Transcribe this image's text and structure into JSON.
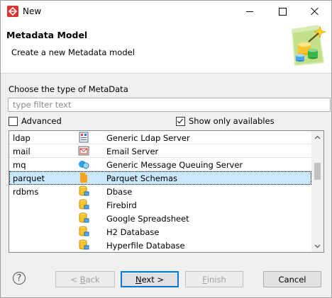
{
  "window": {
    "title": "New",
    "controls": [
      "minimize",
      "maximize",
      "close"
    ]
  },
  "header": {
    "title": "Metadata Model",
    "description": "Create a new Metadata model",
    "image": "metadata-wizard-icon"
  },
  "chooser": {
    "label": "Choose the type of MetaData",
    "filter": {
      "value": "",
      "placeholder": "type filter text"
    },
    "advanced": {
      "label": "Advanced",
      "checked": false
    },
    "show_only_available": {
      "label": "Show only availables",
      "checked": true
    }
  },
  "list": {
    "rows": [
      {
        "name": "ldap",
        "icon": "ldap-server-icon",
        "label": "Generic Ldap Server",
        "selected": false
      },
      {
        "name": "mail",
        "icon": "email-server-icon",
        "label": "Email Server",
        "selected": false
      },
      {
        "name": "mq",
        "icon": "message-queue-icon",
        "label": "Generic Message Queuing Server",
        "selected": false
      },
      {
        "name": "parquet",
        "icon": "parquet-file-icon",
        "label": "Parquet Schemas",
        "selected": true
      },
      {
        "name": "rdbms",
        "icon": "database-icon",
        "label": "Dbase",
        "selected": false
      },
      {
        "name": "",
        "icon": "database-icon",
        "label": "Firebird",
        "selected": false
      },
      {
        "name": "",
        "icon": "database-icon",
        "label": "Google Spreadsheet",
        "selected": false
      },
      {
        "name": "",
        "icon": "database-icon",
        "label": "H2 Database",
        "selected": false
      },
      {
        "name": "",
        "icon": "database-icon",
        "label": "Hyperfile Database",
        "selected": false
      }
    ]
  },
  "buttons": {
    "help": "?",
    "back": {
      "mnemonic": "B",
      "rest": "ack",
      "prefix": "< ",
      "enabled": false
    },
    "next": {
      "mnemonic": "N",
      "rest": "ext >",
      "enabled": true
    },
    "finish": {
      "mnemonic": "F",
      "rest": "inish",
      "enabled": false
    },
    "cancel": {
      "label": "Cancel",
      "enabled": true
    }
  },
  "colors": {
    "selection": "#cce8ff",
    "default_button_border": "#0078d7",
    "app_icon_red": "#d9342b"
  }
}
